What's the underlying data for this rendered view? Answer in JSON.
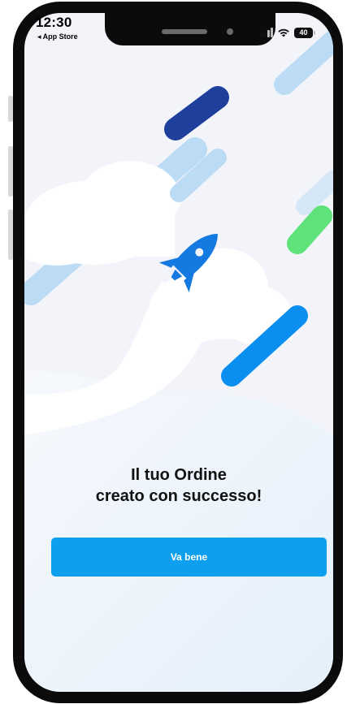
{
  "status_bar": {
    "time": "12:30",
    "back_label": "◂ App Store",
    "battery_level": "40",
    "signal_icon": "cellular-signal-icon",
    "wifi_icon": "wifi-icon"
  },
  "illustration": {
    "icon": "rocket-icon",
    "colors": {
      "rocket": "#1479e0",
      "streak_dark": "#1f3f9c",
      "streak_blue": "#0a8ff0",
      "streak_light": "#bcdcf5",
      "streak_green": "#5fe27a",
      "cloud": "#ffffff"
    }
  },
  "message": {
    "line1": "Il tuo Ordine",
    "line2": "creato con successo!"
  },
  "action": {
    "button_label": "Va bene",
    "button_color": "#0ea0ee"
  }
}
